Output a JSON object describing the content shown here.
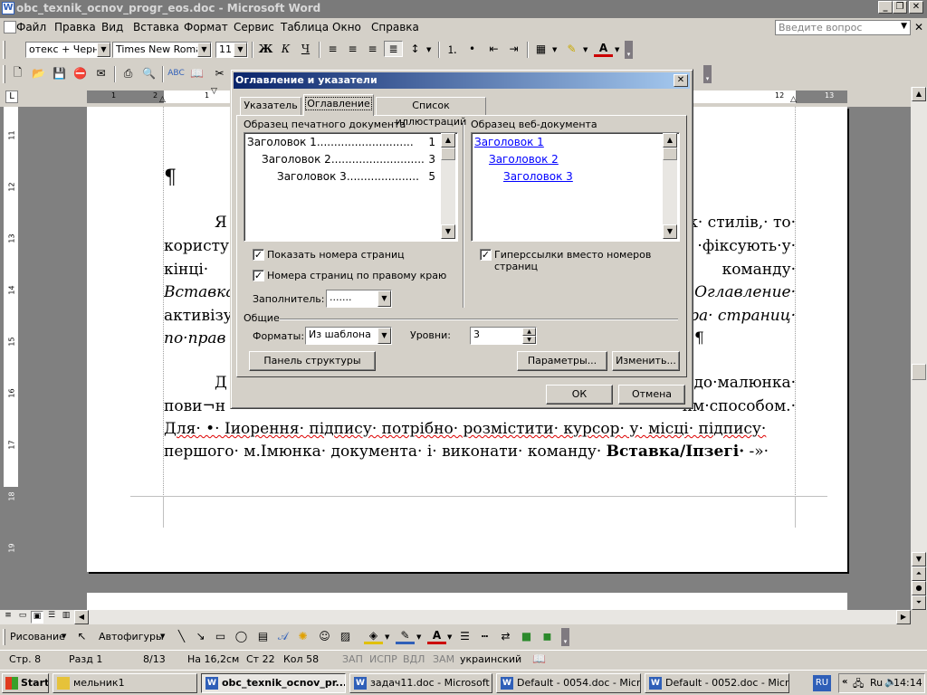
{
  "window": {
    "title": "obc_texnik_ocnov_progr_eos.doc - Microsoft Word"
  },
  "menu": {
    "items": [
      "Файл",
      "Правка",
      "Вид",
      "Вставка",
      "Формат",
      "Сервис",
      "Таблица",
      "Окно",
      "Справка"
    ],
    "question_placeholder": "Введите вопрос"
  },
  "formatting": {
    "style": "отекс + Черне",
    "font": "Times New Roman",
    "size": "11"
  },
  "ruler": {
    "numbers": [
      "1",
      "2",
      "1",
      "12",
      "13"
    ]
  },
  "vruler": {
    "numbers": [
      "11",
      "12",
      "13",
      "14",
      "15",
      "16",
      "17",
      "18",
      "19"
    ]
  },
  "document": {
    "pilcrow": "¶",
    "left_lines": [
      "Я",
      "користу",
      "кінці·",
      "Вставка",
      "активізу",
      "по·прав"
    ],
    "right_lines": [
      "к· стилів,· то·",
      "·фіксують·у·",
      "команду·",
      "Оглавление·",
      "ра· страниц·",
      "¶"
    ],
    "line_d_left": "Д",
    "line_d_right": "до·малюнка·",
    "line_povy_left": "пови¬н",
    "line_povy_right": "им·способом.·",
    "line_dlya": "Для· •· Іиорення· підпису· потрібно· розмістити· курсор· у· місці· підпису·",
    "line_pershogo_a": "першого· м.Імюнка· документа· і· виконати· команду· ",
    "line_pershogo_b": "Вставка/Іпзегі·",
    "line_pershogo_c": " -»·"
  },
  "dialog": {
    "title": "Оглавление и указатели",
    "tabs": [
      "Указатель",
      "Оглавление",
      "Список иллюстраций"
    ],
    "active_tab": "Оглавление",
    "print_preview_label": "Образец печатного документа",
    "web_preview_label": "Образец веб-документа",
    "print_preview": [
      {
        "text": "Заголовок 1",
        "dots": "............................",
        "page": "1"
      },
      {
        "text": "Заголовок 2",
        "dots": "...........................",
        "page": "3"
      },
      {
        "text": "Заголовок 3",
        "dots": ".....................",
        "page": "5"
      }
    ],
    "web_preview": [
      "Заголовок 1",
      "Заголовок 2",
      "Заголовок 3"
    ],
    "show_page_numbers": "Показать номера страниц",
    "right_align_numbers": "Номера страниц по правому краю",
    "hyperlinks": "Гиперссылки вместо номеров страниц",
    "leader_label": "Заполнитель:",
    "leader_value": ".......",
    "general_label": "Общие",
    "formats_label": "Форматы:",
    "formats_value": "Из шаблона",
    "levels_label": "Уровни:",
    "levels_value": "3",
    "outline_toolbar_button": "Панель структуры",
    "options_button": "Параметры...",
    "modify_button": "Изменить...",
    "ok_button": "ОК",
    "cancel_button": "Отмена"
  },
  "drawing": {
    "draw_label": "Рисование",
    "autoshapes_label": "Автофигуры"
  },
  "status": {
    "page": "Стр. 8",
    "section": "Разд 1",
    "pages": "8/13",
    "at": "На 16,2см",
    "line": "Ст 22",
    "col": "Кол 58",
    "rec": "ЗАП",
    "trk": "ИСПР",
    "ext": "ВДЛ",
    "ovr": "ЗАМ",
    "language": "украинский"
  },
  "taskbar": {
    "start": "Start",
    "buttons": [
      "мельник1",
      "obc_texnik_ocnov_pr...",
      "задач11.doc - Microsoft ...",
      "Default - 0054.doc - Micr...",
      "Default - 0052.doc - Micr..."
    ],
    "lang": "RU",
    "tray_lang": "Ru",
    "clock": "14:14"
  },
  "colors": {
    "titlebar": "#7a7a7a",
    "dialog_titlebar": "#0a246a",
    "link": "#0000ff",
    "desktop_gray": "#808080"
  }
}
